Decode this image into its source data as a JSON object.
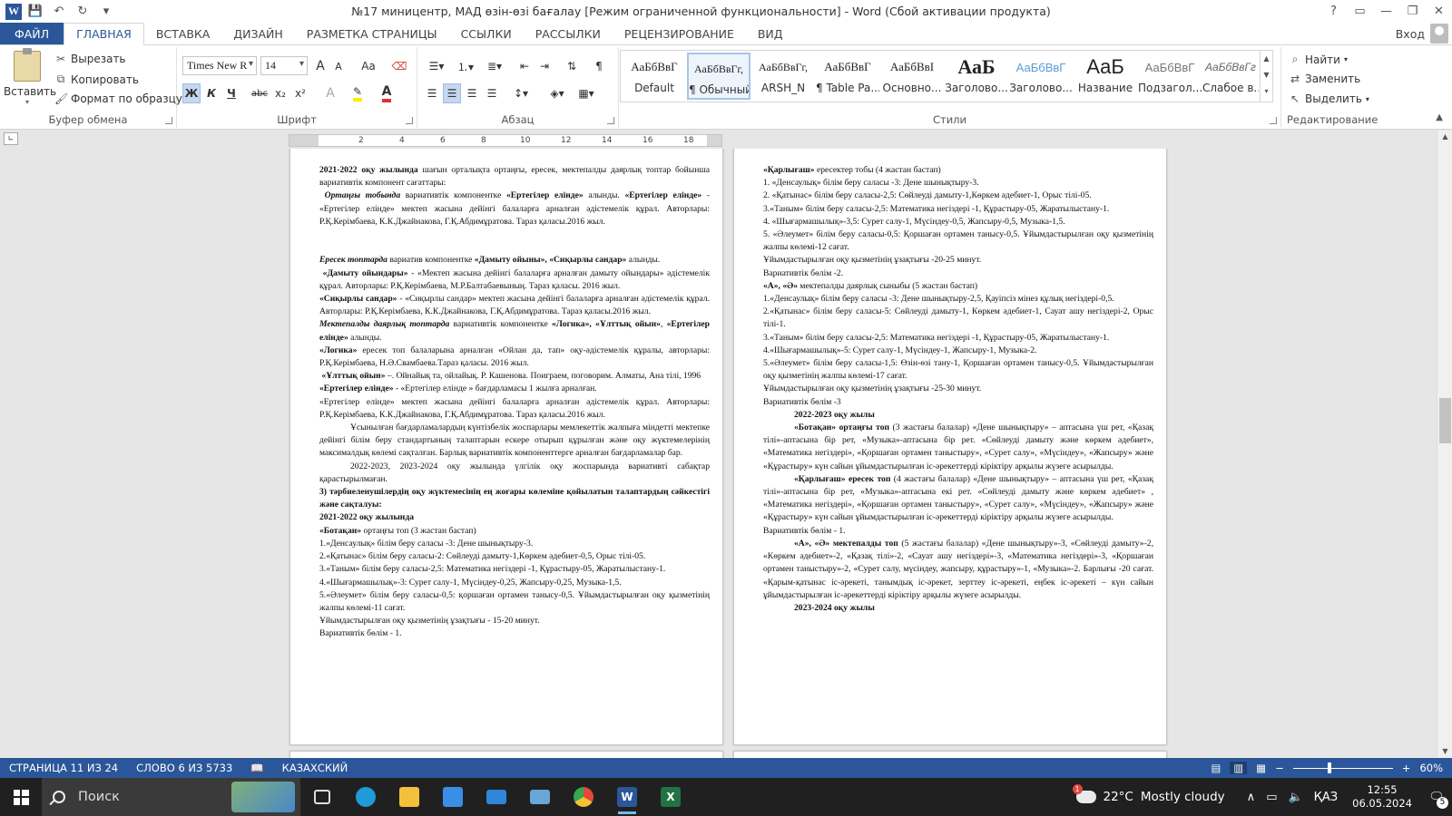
{
  "window": {
    "title": "№17 миницентр, МАД өзін-өзі бағалау [Режим ограниченной функциональности] - Word (Сбой активации продукта)",
    "help": "?"
  },
  "tabs": [
    {
      "label": "ФАЙЛ"
    },
    {
      "label": "ГЛАВНАЯ"
    },
    {
      "label": "ВСТАВКА"
    },
    {
      "label": "ДИЗАЙН"
    },
    {
      "label": "РАЗМЕТКА СТРАНИЦЫ"
    },
    {
      "label": "ССЫЛКИ"
    },
    {
      "label": "РАССЫЛКИ"
    },
    {
      "label": "РЕЦЕНЗИРОВАНИЕ"
    },
    {
      "label": "ВИД"
    }
  ],
  "login": "Вход",
  "clipboard": {
    "paste": "Вставить",
    "cut": "Вырезать",
    "copy": "Копировать",
    "format_painter": "Формат по образцу",
    "label": "Буфер обмена"
  },
  "font": {
    "name": "Times New R",
    "size": "14",
    "label": "Шрифт",
    "bold": "Ж",
    "italic": "К",
    "underline": "Ч",
    "strike": "abc",
    "sub": "x₂",
    "sup": "x²",
    "grow": "A",
    "shrink": "A",
    "case": "Aa",
    "color_a": "A",
    "effects_a": "A"
  },
  "paragraph": {
    "label": "Абзац",
    "pilcrow": "¶"
  },
  "styles": {
    "label": "Стили",
    "items": [
      {
        "preview": "АаБбВвГ",
        "name": "Default"
      },
      {
        "preview": "АаБбВвГг,",
        "name": "¶ Обычный"
      },
      {
        "preview": "АаБбВвГг,",
        "name": "ARSH_N"
      },
      {
        "preview": "АаБбВвГ",
        "name": "¶ Table Pa..."
      },
      {
        "preview": "АаБбВвІ",
        "name": "Основно..."
      },
      {
        "preview": "АаБ",
        "name": "Заголово..."
      },
      {
        "preview": "АаБбВвГ",
        "name": "Заголово..."
      },
      {
        "preview": "АаБ",
        "name": "Название"
      },
      {
        "preview": "АаБбВвГ",
        "name": "Подзагол..."
      },
      {
        "preview": "АаБбВвГг",
        "name": "Слабое в..."
      }
    ]
  },
  "editing": {
    "label": "Редактирование",
    "find": "Найти",
    "replace": "Заменить",
    "select": "Выделить"
  },
  "ruler": {
    "nums": [
      "2",
      "4",
      "6",
      "8",
      "10",
      "12",
      "14",
      "16",
      "18"
    ]
  },
  "page_left": [
    {
      "cls": "",
      "html": "<b>2021-2022 оқу жылында</b> шағын орталықта ортаңғы, ересек, мектепалды даярлық топтар бойынша вариативтік компонент сағаттары:"
    },
    {
      "cls": "",
      "html": "&nbsp;<b><i>Ортаңғы тобында</i></b> вариативтік компонентке <b>«Ертегілер елінде»</b> алынды. <b>«Ертегілер елінде»</b> - «Ертегілер елінде» мектеп жасына дейінгі балаларға арналған әдістемелік құрал. Авторлары: Р.Қ.Керімбаева, К.К.Джайнакова, Г.Қ.Абдимұратова. Тараз қаласы.2016 жыл."
    },
    {
      "cls": "",
      "html": "&nbsp;"
    },
    {
      "cls": "",
      "html": "&nbsp;"
    },
    {
      "cls": "",
      "html": "<b><i>Ересек топтарда</i></b> вариатив компонентке <b>«Дамыту ойыны», «Сиқырлы сандар»</b> алынды."
    },
    {
      "cls": "",
      "html": "&nbsp;<b>«Дамыту ойындары»</b> - «Мектеп жасына дейінгі балаларға арналған дамыту ойындары» әдістемелік құрал. Авторлары: Р.Қ.Керімбаева, М.Р.Балтабаевының. Тараз қаласы. 2016 жыл."
    },
    {
      "cls": "",
      "html": "<b>«Сиқырлы сандар»</b> - «Сиқырлы сандар» мектеп жасына дейінгі балаларға арналған әдістемелік құрал. Авторлары: Р.Қ.Керімбаева, К.К.Джайнакова, Г.Қ.Абдимұратова. Тараз қаласы.2016 жыл."
    },
    {
      "cls": "",
      "html": "<b><i>Мектепалды даярлық топтарда</i></b> вариативтік компонентке <b>«Логика», «Ұлттық ойын»</b>, <b>«Ертегілер елінде»</b> алынды."
    },
    {
      "cls": "",
      "html": "<b>«Логика»</b> ересек топ балаларына арналған «Ойлан да, тап» оқу-әдістемелік құралы, авторлары: Р.Қ.Керімбаева, Н.Ә.Свамбаева.Тараз қаласы. 2016 жыл."
    },
    {
      "cls": "",
      "html": "&nbsp;<b>«Ұлттық ойын»</b> –. Ойнайық та, ойлайық. Р. Кашенова. Поиграем, поговорим. Алматы, Ана тілі, 1996"
    },
    {
      "cls": "",
      "html": "<b>«Ертегілер елінде»</b> - «Ертегілер елінде » бағдарламасы 1 жылға арналған."
    },
    {
      "cls": "",
      "html": "«Ертегілер елінде» мектеп жасына дейінгі балаларға арналған әдістемелік құрал. Авторлары: Р.Қ.Керімбаева, К.К.Джайнакова, Г.Қ.Абдимұратова. Тараз қаласы.2016 жыл."
    },
    {
      "cls": "ind",
      "html": "Ұсынылған бағдарламалардың күнтізбелік жоспарлары мемлекеттік жалпыға міндетті мектепке дейінгі білім беру стандартының талаптарын ескере отырып құрылған және оқу жүктемелерінің максималдық көлемі сақталған. Барлық вариативтік компоненттерге арналған бағдарламалар бар."
    },
    {
      "cls": "ind",
      "html": "2022-2023, 2023-2024 оқу жылында үлгілік оқу жоспарында вариативті сабақтар қарастырылмаған."
    },
    {
      "cls": "",
      "html": "<b>3) тәрбиеленушілердің оқу жүктемесінің ең жоғары көлеміне қойылатын талаптардың сәйкестігі және сақталуы:</b>"
    },
    {
      "cls": "",
      "html": "<b>2021-2022 оқу жылында</b>"
    },
    {
      "cls": "",
      "html": "<b>«Ботақан»</b> ортаңғы топ (3 жастан бастап)"
    },
    {
      "cls": "",
      "html": "1.«Денсаулық» білім беру саласы -3: Дене шынықтыру-3."
    },
    {
      "cls": "",
      "html": "2.«Қатынас» білім беру саласы-2: Сөйлеуді дамыту-1,Көркем әдебиет-0,5, Орыс тілі-05."
    },
    {
      "cls": "",
      "html": "3.«Таным» білім беру саласы-2,5: Математика негіздері -1, Құрастыру-05, Жаратылыстану-1."
    },
    {
      "cls": "",
      "html": "4.«Шығармашылық»-3: Сурет салу-1, Мүсіндеу-0,25, Жапсыру-0,25, Музыка-1,5."
    },
    {
      "cls": "",
      "html": "5.«Әлеумет» білім беру саласы-0,5: қоршаған ортамен танысу-0,5. Ұйымдастырылған оқу қызметінің жалпы көлемі-11 сағат."
    },
    {
      "cls": "",
      "html": "Ұйымдастырылған оқу қызметінің ұзақтығы - 15-20 минут."
    },
    {
      "cls": "",
      "html": "Вариативтік бөлім - 1."
    }
  ],
  "page_right": [
    {
      "cls": "",
      "html": "<b>«Қарлығаш»</b> ересектер тобы (4 жастан бастап)"
    },
    {
      "cls": "",
      "html": "1. «Денсаулық» білім беру саласы -3: Дене шынықтыру-3."
    },
    {
      "cls": "",
      "html": "2. «Қатынас» білім беру саласы-2,5: Сөйлеуді дамыту-1,Көркем әдебиет-1, Орыс тілі-05."
    },
    {
      "cls": "",
      "html": "3.«Таным» білім беру саласы-2,5: Математика негіздері -1, Құрастыру-05, Жаратылыстану-1."
    },
    {
      "cls": "",
      "html": "4. «Шығармашылық»-3,5: Сурет салу-1, Мүсіндеу-0,5, Жапсыру-0,5, Музыка-1,5."
    },
    {
      "cls": "",
      "html": "5. «Әлеумет» білім беру саласы-0,5: Қоршаған ортамен танысу-0,5. Ұйымдастырылған оқу қызметінің жалпы көлемі-12 сағат."
    },
    {
      "cls": "",
      "html": "Ұйымдастырылған оқу қызметінің ұзақтығы -20-25 минут."
    },
    {
      "cls": "",
      "html": "Вариативтік бөлім -2."
    },
    {
      "cls": "",
      "html": "<b>«А», «Ә»</b> мектепалды даярлық сыныбы (5 жастан бастап)"
    },
    {
      "cls": "",
      "html": "1.«Денсаулық» білім беру саласы -3: Дене шынықтыру-2,5, Қауіпсіз мінез құлық негіздері-0,5."
    },
    {
      "cls": "",
      "html": "2.«Қатынас» білім беру саласы-5: Сөйлеуді дамыту-1, Көркем әдебиет-1, Сауат ашу негіздері-2, Орыс тілі-1."
    },
    {
      "cls": "",
      "html": "3.«Таным» білім беру саласы-2,5: Математика негіздері -1, Құрастыру-05, Жаратылыстану-1."
    },
    {
      "cls": "",
      "html": "4.«Шығармашылық»-5: Сурет салу-1, Мүсіндеу-1, Жапсыру-1, Музыка-2."
    },
    {
      "cls": "",
      "html": "5.«Әлеумет» білім беру саласы-1,5: Өзін-өзі тану-1, Қоршаған ортамен танысу-0,5. Ұйымдастырылған оқу қызметінің жалпы көлемі-17 сағат."
    },
    {
      "cls": "",
      "html": "Ұйымдастырылған оқу қызметінің ұзақтығы -25-30 минут."
    },
    {
      "cls": "",
      "html": "Вариативтік бөлім -3"
    },
    {
      "cls": "ctr",
      "html": "<b>2022-2023 оқу жылы</b>"
    },
    {
      "cls": "ind",
      "html": "<b>«Ботақан» ортаңғы топ</b> (3 жастағы балалар) «Дене шынықтыру» – аптасына үш рет, «Қазақ тілі»-аптасына бір рет, «Музыка»-аптасына бір рет. «Сөйлеуді дамыту және көркем әдебиет», «Математика негіздері», «Қоршаған ортамен таныстыру», «Сурет салу», «Мүсіндеу», «Жапсыру» және «Құрастыру» күн сайын ұйымдастырылған іс-әрекеттерді кіріктіру арқылы жүзеге асырылды."
    },
    {
      "cls": "ind",
      "html": "<b>«Қарлығаш» ересек топ</b> (4 жастағы балалар) «Дене шынықтыру» – аптасына үш рет, «Қазақ тілі»-аптасына бір рет, «Музыка»-аптасына екі рет. «Сөйлеуді дамыту және көркем әдебиет» , «Математика негіздері», «Қоршаған ортамен таныстыру», «Сурет салу», «Мүсіндеу», «Жапсыру» және «Құрастыру» күн сайын ұйымдастырылған іс-әрекеттерді кіріктіру арқылы жүзеге асырылды."
    },
    {
      "cls": "",
      "html": "Вариативтік бөлім - 1."
    },
    {
      "cls": "ind",
      "html": "<b>«А», «Ә» мектепалды топ</b> (5 жастағы балалар) «Дене шынықтыру»-3, «Сөйлеуді дамыту»-2, «Көркем әдебиет»-2, «Қазақ тілі»-2, «Сауат ашу негіздері»-3, «Математика негіздері»-3, «Қоршаған ортамен таныстыру»-2, «Сурет салу, мүсіндеу, жапсыру, құрастыру»-1, «Музыка»-2. Барлығы -20 сағат. «Қарым-қатынас іс-әрекеті, танымдық іс-әрекет, зерттеу іс-әрекеті, еңбек іс-әрекеті – күн сайын ұйымдастырылған іс-әрекеттерді кіріктіру арқылы жүзеге асырылды."
    },
    {
      "cls": "ctr",
      "html": "<b>2023-2024 оқу жылы</b>"
    }
  ],
  "status": {
    "page": "СТРАНИЦА 11 ИЗ 24",
    "words": "СЛОВО 6 ИЗ 5733",
    "lang": "КАЗАХСКИЙ",
    "zoom": "60%"
  },
  "taskbar": {
    "search": "Поиск",
    "weather_temp": "22°C",
    "weather_desc": "Mostly cloudy",
    "weather_badge": "1",
    "lang": "ҚАЗ",
    "time": "12:55",
    "date": "06.05.2024",
    "notif_count": "5",
    "apps": [
      {
        "name": "task-view",
        "color": "#202020"
      },
      {
        "name": "edge",
        "color": "#1f9bd7"
      },
      {
        "name": "explorer",
        "color": "#f3c03c"
      },
      {
        "name": "store",
        "color": "#3b8ee5"
      },
      {
        "name": "mail",
        "color": "#2f86d9"
      },
      {
        "name": "remote",
        "color": "#6aa5da"
      },
      {
        "name": "chrome",
        "color": "#e3483a"
      },
      {
        "name": "word",
        "color": "#2b579a"
      },
      {
        "name": "excel",
        "color": "#217346"
      }
    ]
  }
}
